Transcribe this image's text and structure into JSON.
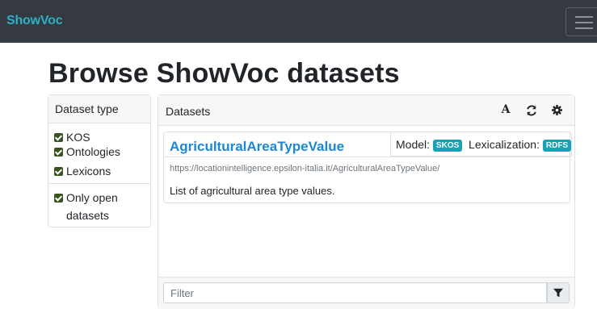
{
  "navbar": {
    "brand": "ShowVoc",
    "menu_icon": "hamburger-icon"
  },
  "page": {
    "title": "Browse ShowVoc datasets"
  },
  "dataset_type": {
    "header": "Dataset type",
    "types": [
      {
        "label": "KOS",
        "checked": true
      },
      {
        "label": "Ontologies",
        "checked": true
      },
      {
        "label": "Lexicons",
        "checked": true
      }
    ],
    "only_open": {
      "label_line1": "Only open",
      "label_line2": "datasets",
      "checked": true
    }
  },
  "datasets_panel": {
    "header": "Datasets",
    "icons": {
      "sort": "font-a-icon",
      "refresh": "refresh-icon",
      "settings": "gear-icon"
    },
    "items": [
      {
        "name": "AgriculturalAreaTypeValue",
        "model_label": "Model:",
        "model": "SKOS",
        "lexicalization_label": "Lexicalization:",
        "lexicalization": "RDFS",
        "url": "https://locationintelligence.epsilon-italia.it/AgriculturalAreaTypeValue/",
        "description": "List of agricultural area type values."
      }
    ],
    "filter": {
      "placeholder": "Filter",
      "value": "",
      "icon": "filter-icon"
    }
  },
  "colors": {
    "navbar_bg": "#343a40",
    "brand": "#2fb0c6",
    "link": "#1a88d8",
    "badge": "#17a2b8",
    "checkbox": "#3b5323"
  }
}
